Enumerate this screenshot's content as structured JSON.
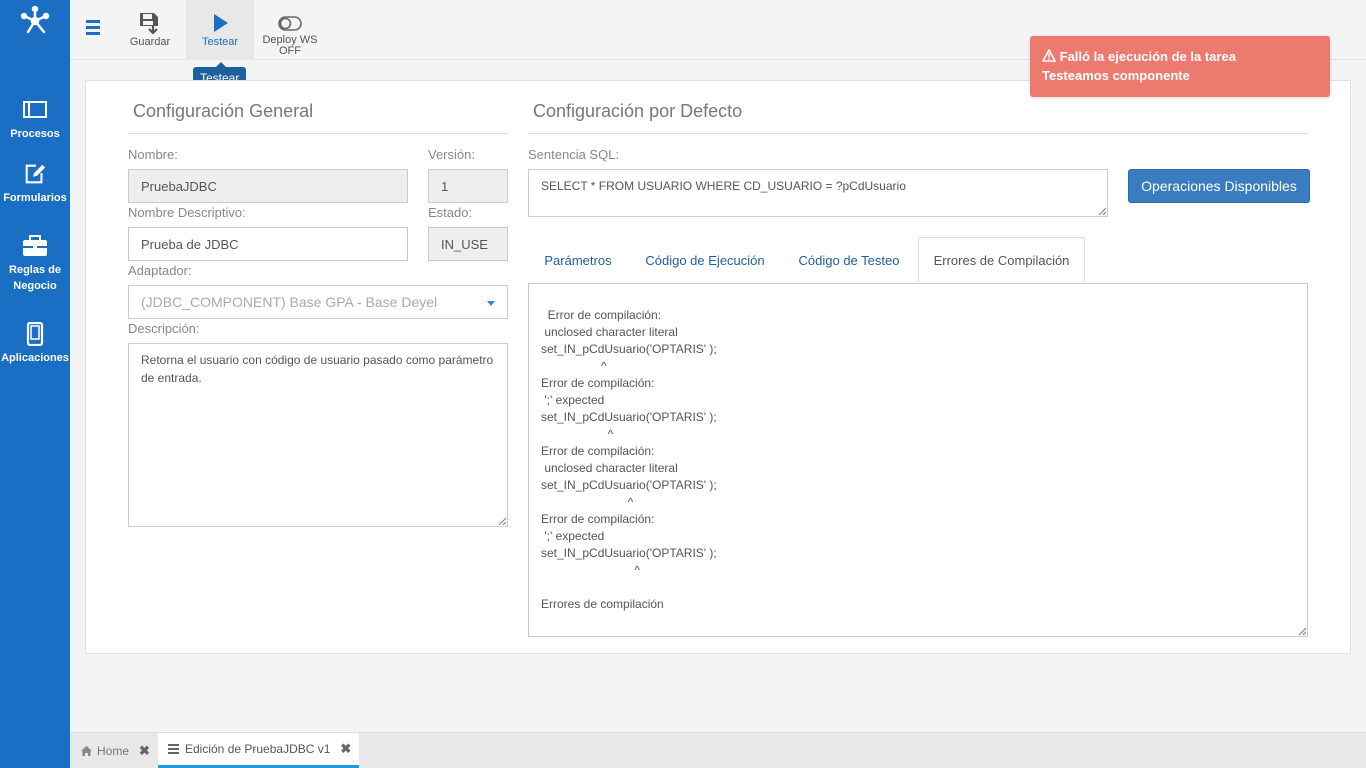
{
  "sidebar": {
    "items": [
      {
        "label": "Procesos",
        "icon": "process-icon"
      },
      {
        "label": "Formularios",
        "icon": "edit-icon"
      },
      {
        "label": "Reglas de Negocio",
        "icon": "briefcase-icon"
      },
      {
        "label": "Aplicaciones",
        "icon": "mobile-icon"
      }
    ]
  },
  "toolbar": {
    "save_label": "Guardar",
    "test_label": "Testear",
    "deploy_label": "Deploy WS",
    "deploy_state": "OFF",
    "tooltip": "Testear"
  },
  "alert": {
    "title": "Falló la ejecución de la tarea",
    "message": "Testeamos componente",
    "color": "#ec7a6f"
  },
  "general": {
    "title": "Configuración General",
    "name_label": "Nombre:",
    "name_value": "PruebaJDBC",
    "version_label": "Versión:",
    "version_value": "1",
    "desc_name_label": "Nombre Descriptivo:",
    "desc_name_value": "Prueba de JDBC",
    "state_label": "Estado:",
    "state_value": "IN_USE",
    "adapter_label": "Adaptador:",
    "adapter_value": "(JDBC_COMPONENT) Base GPA - Base Deyel",
    "description_label": "Descripción:",
    "description_value": "Retorna el usuario con código de usuario pasado como parámetro de entrada."
  },
  "defaults": {
    "title": "Configuración por Defecto",
    "sql_label": "Sentencia SQL:",
    "sql_value": "SELECT * FROM USUARIO WHERE CD_USUARIO = ?pCdUsuario",
    "operations_button": "Operaciones Disponibles",
    "tabs": [
      {
        "label": "Parámetros"
      },
      {
        "label": "Código de Ejecución"
      },
      {
        "label": "Código de Testeo"
      },
      {
        "label": "Errores de Compilación"
      }
    ],
    "errors_text": "Error de compilación:\n unclosed character literal\nset_IN_pCdUsuario('OPTARIS' );\n                  ^\nError de compilación:\n ';' expected\nset_IN_pCdUsuario('OPTARIS' );\n                    ^\nError de compilación:\n unclosed character literal\nset_IN_pCdUsuario('OPTARIS' );\n                          ^\nError de compilación:\n ';' expected\nset_IN_pCdUsuario('OPTARIS' );\n                            ^\n\nErrores de compilación"
  },
  "bottom_tabs": [
    {
      "label": "Home",
      "icon": "home-icon"
    },
    {
      "label": "Edición de PruebaJDBC v1",
      "icon": "list-icon"
    }
  ],
  "colors": {
    "brand": "#1a6fc4",
    "accent": "#1a9be0",
    "primary_button": "#3a7cc0"
  }
}
